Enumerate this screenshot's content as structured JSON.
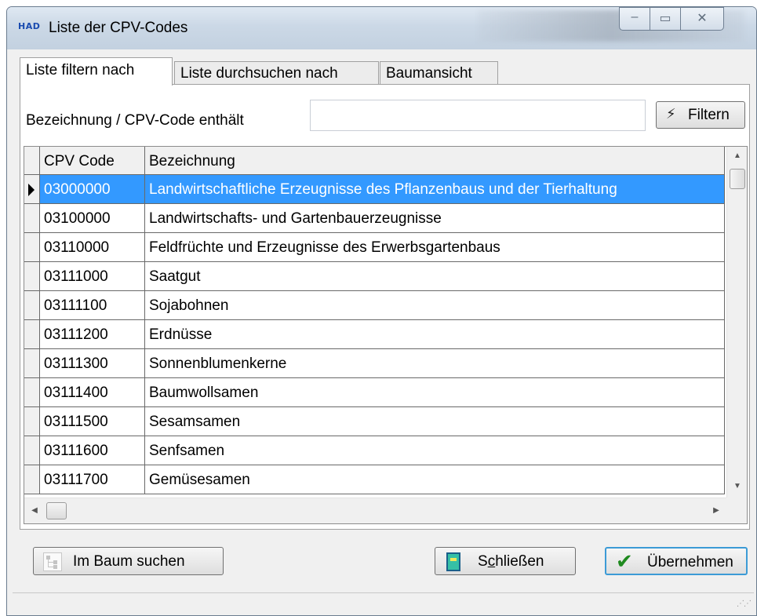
{
  "window": {
    "app_logo": "HAD",
    "title": "Liste der CPV-Codes",
    "controls": {
      "minimize": "–",
      "maximize": "▭",
      "close": "✕"
    }
  },
  "tabs": [
    {
      "label": "Liste filtern nach",
      "active": true
    },
    {
      "label": "Liste durchsuchen nach",
      "active": false
    },
    {
      "label": "Baumansicht",
      "active": false
    }
  ],
  "filter": {
    "label": "Bezeichnung / CPV-Code enthält",
    "value": "",
    "button_label": "Filtern"
  },
  "table": {
    "columns": [
      "CPV Code",
      "Bezeichnung"
    ],
    "selected_index": 0,
    "rows": [
      {
        "code": "03000000",
        "bezeichnung": "Landwirtschaftliche Erzeugnisse des Pflanzenbaus und der Tierhaltung"
      },
      {
        "code": "03100000",
        "bezeichnung": "Landwirtschafts- und Gartenbauerzeugnisse"
      },
      {
        "code": "03110000",
        "bezeichnung": "Feldfrüchte und Erzeugnisse des Erwerbsgartenbaus"
      },
      {
        "code": "03111000",
        "bezeichnung": "Saatgut"
      },
      {
        "code": "03111100",
        "bezeichnung": "Sojabohnen"
      },
      {
        "code": "03111200",
        "bezeichnung": "Erdnüsse"
      },
      {
        "code": "03111300",
        "bezeichnung": "Sonnenblumenkerne"
      },
      {
        "code": "03111400",
        "bezeichnung": "Baumwollsamen"
      },
      {
        "code": "03111500",
        "bezeichnung": "Sesamsamen"
      },
      {
        "code": "03111600",
        "bezeichnung": "Senfsamen"
      },
      {
        "code": "03111700",
        "bezeichnung": "Gemüsesamen"
      }
    ]
  },
  "buttons": {
    "tree_search": "Im Baum suchen",
    "close_pre": "S",
    "close_mnemonic": "c",
    "close_post": "hließen",
    "accept": "Übernehmen"
  },
  "icons": {
    "scroll_up": "▲",
    "scroll_down": "▼",
    "scroll_left": "◀",
    "scroll_right": "▶",
    "filter": "lightning-icon",
    "accept": "checkmark-icon",
    "close": "door-icon",
    "tree": "tree-icon"
  },
  "colors": {
    "selection": "#3399ff",
    "accept_border": "#3c9bd6"
  }
}
